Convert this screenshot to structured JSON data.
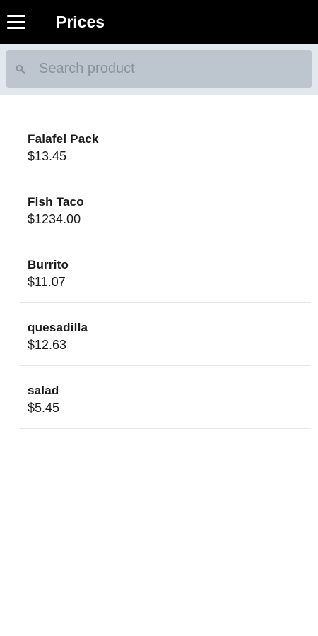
{
  "header": {
    "title": "Prices"
  },
  "search": {
    "placeholder": "Search product",
    "value": ""
  },
  "products": [
    {
      "name": "Falafel Pack",
      "price": "$13.45"
    },
    {
      "name": "Fish Taco",
      "price": "$1234.00"
    },
    {
      "name": "Burrito",
      "price": "$11.07"
    },
    {
      "name": "quesadilla",
      "price": "$12.63"
    },
    {
      "name": "salad",
      "price": "$5.45"
    }
  ],
  "colors": {
    "header_bg": "#000000",
    "search_bar_bg": "#e1e8ee",
    "search_input_bg": "#bdc6cf",
    "placeholder": "#86939e"
  },
  "icons": {
    "menu": "hamburger-menu-icon",
    "search": "search-icon"
  }
}
